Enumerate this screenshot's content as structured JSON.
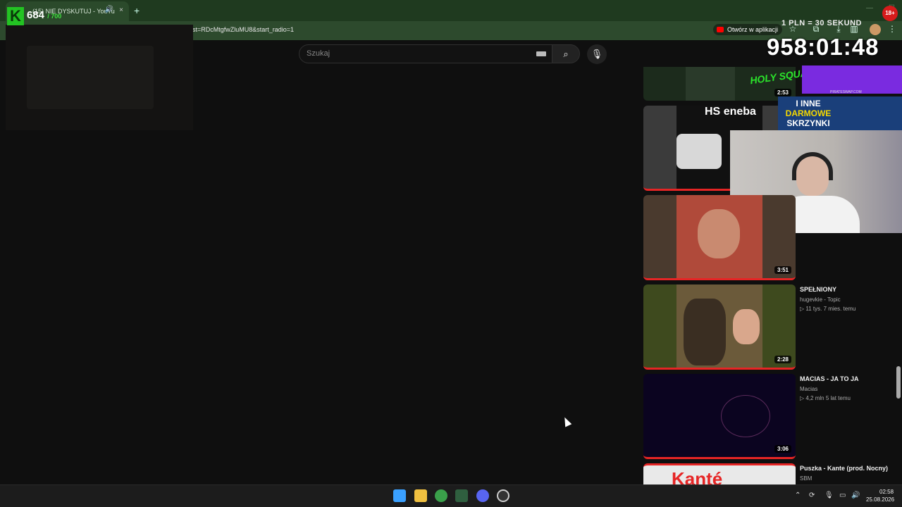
{
  "browser": {
    "tab_title": "(15) NIE DYSKUTUJ - YouTu",
    "new_tab": "+",
    "tab_close": "×",
    "url_fragment": "st=RDcMtgfwZluMU8&start_radio=1",
    "open_in_app": "Otwórz w aplikacji"
  },
  "overlay": {
    "logo_letter": "K",
    "counter": "684",
    "counter_max": "/ 700",
    "pln_label": "1 PLN = 30 SEKUND",
    "timer": "958:01:48",
    "age_badge": "18+",
    "eneba_hs": "HS",
    "eneba_brand": "eneba",
    "skrzynki_line1": "I INNE",
    "skrzynki_line2": "DARMOWE",
    "skrzynki_line3": "SKRZYNKI",
    "holy_text": "HOLY SQUAD",
    "pirate_text": "PIRATESWAP.COM"
  },
  "youtube": {
    "search_placeholder": "Szukaj",
    "playlist": [
      {
        "duration": "2:53"
      },
      {
        "duration": ""
      },
      {
        "duration": "3:51"
      },
      {
        "title": "SPEŁNIONY",
        "channel": "hugevkie - Topic",
        "meta": "▷ 11 tys.  7 mies. temu",
        "duration": "2:28"
      },
      {
        "title": "MACIAS - JA TO JA",
        "channel": "Macias",
        "meta": "▷ 4,2 mln  5 lat temu",
        "duration": "3:06"
      },
      {
        "title": "Puszka - Kante (prod. Nocny)",
        "channel": "SBM",
        "thumb_text": "Kanté"
      }
    ]
  },
  "taskbar": {
    "time": "02:58",
    "date": "25.08.2026"
  },
  "colors": {
    "accent_green": "#23c323",
    "youtube_red": "#e62525"
  }
}
